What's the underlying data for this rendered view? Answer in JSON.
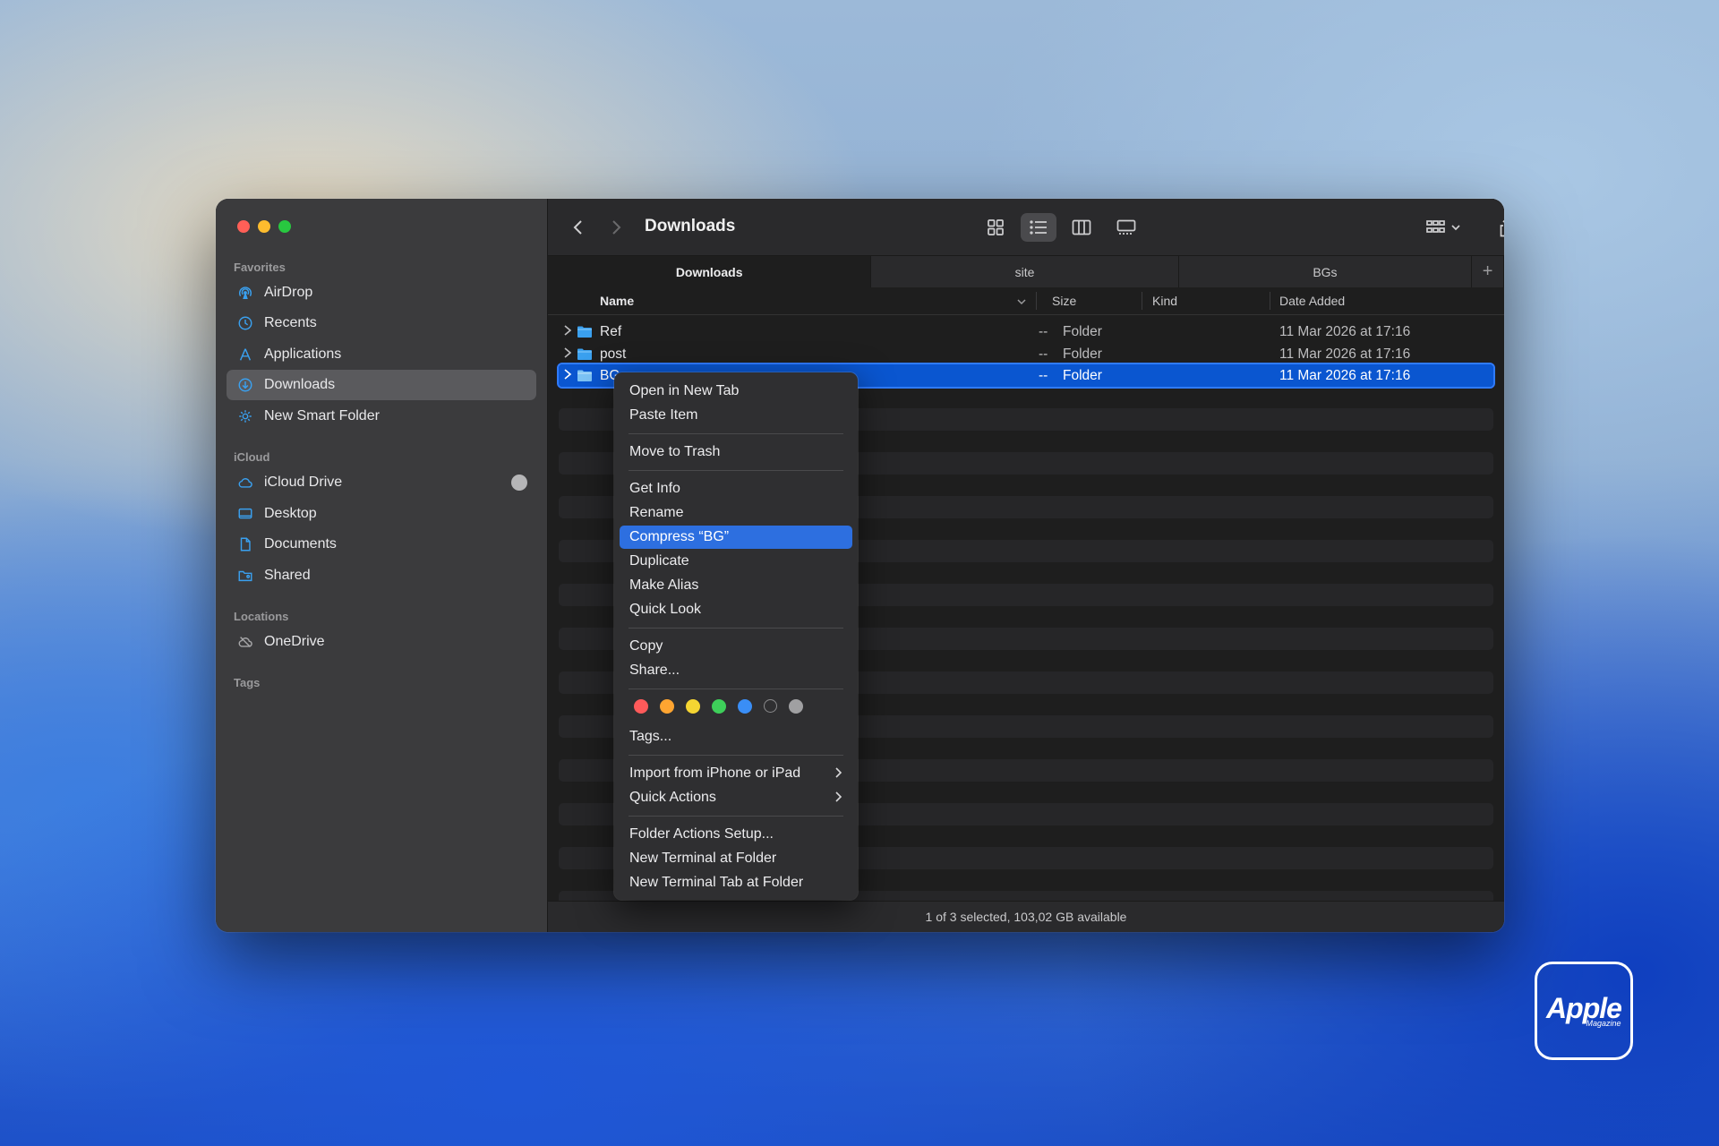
{
  "colors": {
    "accent": "#2f7bff",
    "menu_highlight": "#2d6fe0",
    "folder_blue": "#3aa0ef"
  },
  "window": {
    "title": "Downloads"
  },
  "sidebar": {
    "sections": {
      "favorites": "Favorites",
      "icloud": "iCloud",
      "locations": "Locations",
      "tags": "Tags"
    },
    "favorites": [
      {
        "label": "AirDrop",
        "icon": "airdrop-icon"
      },
      {
        "label": "Recents",
        "icon": "clock-icon"
      },
      {
        "label": "Applications",
        "icon": "applications-icon"
      },
      {
        "label": "Downloads",
        "icon": "download-icon",
        "active": true
      },
      {
        "label": "New Smart Folder",
        "icon": "gear-folder-icon"
      }
    ],
    "icloud": [
      {
        "label": "iCloud Drive",
        "icon": "cloud-icon"
      },
      {
        "label": "Desktop",
        "icon": "desktop-icon"
      },
      {
        "label": "Documents",
        "icon": "document-icon"
      },
      {
        "label": "Shared",
        "icon": "shared-folder-icon"
      }
    ],
    "locations": [
      {
        "label": "OneDrive",
        "icon": "cloud-slash-icon"
      }
    ]
  },
  "tabs": [
    {
      "label": "Downloads",
      "active": true
    },
    {
      "label": "site"
    },
    {
      "label": "BGs"
    }
  ],
  "columns": {
    "name": "Name",
    "size": "Size",
    "kind": "Kind",
    "date_added": "Date Added"
  },
  "files": [
    {
      "name": "Ref",
      "size": "--",
      "kind": "Folder",
      "date_added": "11 Mar 2026 at 17:16"
    },
    {
      "name": "post",
      "size": "--",
      "kind": "Folder",
      "date_added": "11 Mar 2026 at 17:16"
    },
    {
      "name": "BG",
      "size": "--",
      "kind": "Folder",
      "date_added": "11 Mar 2026 at 17:16",
      "selected": true
    }
  ],
  "context_menu": {
    "items": [
      {
        "label": "Open in New Tab"
      },
      {
        "label": "Paste Item"
      },
      {
        "label": "Move to Trash"
      },
      {
        "label": "Get Info"
      },
      {
        "label": "Rename"
      },
      {
        "label": "Compress “BG”",
        "highlighted": true
      },
      {
        "label": "Duplicate"
      },
      {
        "label": "Make Alias"
      },
      {
        "label": "Quick Look"
      },
      {
        "label": "Copy"
      },
      {
        "label": "Share..."
      },
      {
        "label": "Tags..."
      },
      {
        "label": "Import from iPhone or iPad",
        "submenu": true
      },
      {
        "label": "Quick Actions",
        "submenu": true
      },
      {
        "label": "Folder Actions Setup..."
      },
      {
        "label": "New Terminal at Folder"
      },
      {
        "label": "New Terminal Tab at Folder"
      }
    ],
    "tag_colors": [
      "#ff5a5a",
      "#ffa531",
      "#f5d532",
      "#3ecf5a",
      "#3a8ef6",
      "none",
      "#a0a0a2"
    ]
  },
  "status": "1 of 3 selected, 103,02 GB available",
  "watermark": {
    "brand": "Apple",
    "sub": "Magazine"
  }
}
